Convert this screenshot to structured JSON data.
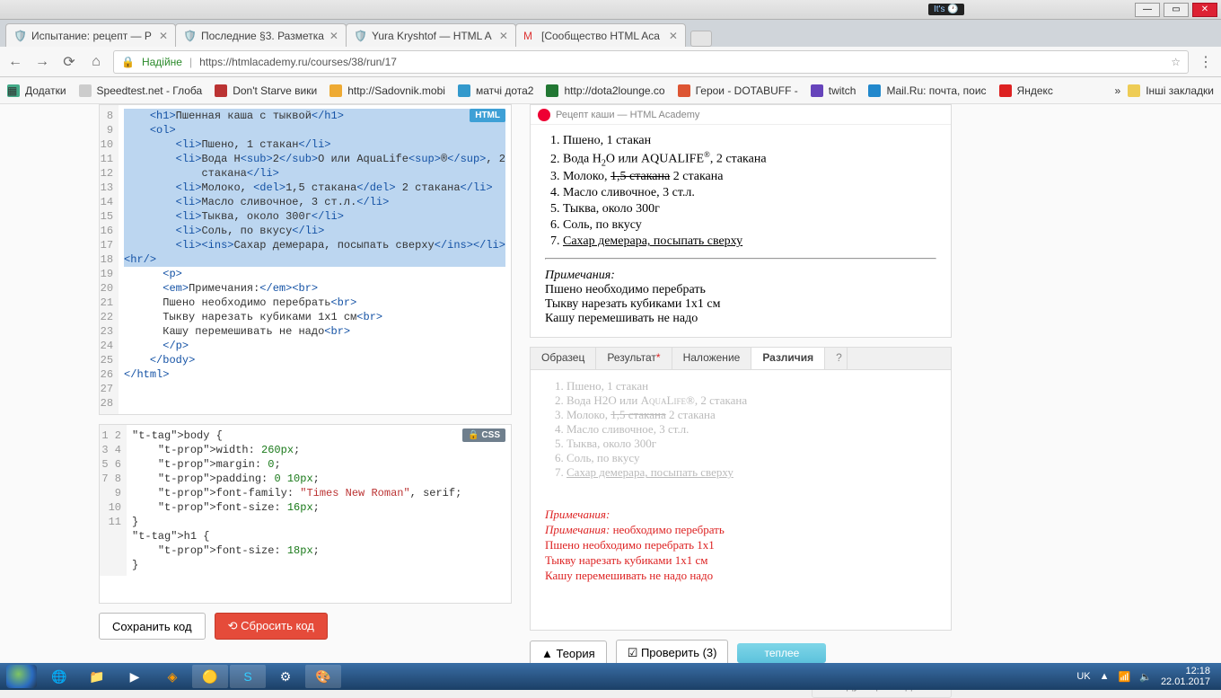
{
  "window": {
    "brand": "It's 🕐",
    "min": "—",
    "max": "▭",
    "close": "✕"
  },
  "tabs": [
    {
      "label": "Испытание: рецепт — Р",
      "close": "✕"
    },
    {
      "label": "Последние §3. Разметка",
      "close": "✕"
    },
    {
      "label": "Yura Kryshtof — HTML A",
      "close": "✕"
    },
    {
      "label": "[Сообщество HTML Aca",
      "close": "✕"
    }
  ],
  "toolbar": {
    "back": "←",
    "fwd": "→",
    "reload": "⟳",
    "home": "⌂",
    "secure": "Надійне",
    "url": "https://htmlacademy.ru/courses/38/run/17",
    "star": "☆",
    "menu": "⋮"
  },
  "bookmarks": {
    "apps": "Додатки",
    "items": [
      "Speedtest.net - Глоба",
      "Don't Starve вики",
      "http://Sadovnik.mobi",
      "матчі дота2",
      "http://dota2lounge.co",
      "Герои - DOTABUFF -",
      "twitch",
      "Mail.Ru: почта, поис",
      "Яндекс"
    ],
    "other": "Інші закладки"
  },
  "htmlEditor": {
    "badge": "HTML",
    "start": 8,
    "lines": [
      "    <h1>Пшенная каша с тыквой</h1>",
      "    <ol>",
      "        <li>Пшено, 1 стакан</li>",
      "        <li>Вода H<sub>2</sub>O или AquaLife<sup>®</sup>, 2\n            стакана</li>",
      "        <li>Молоко, <del>1,5 стакана</del> 2 стакана</li>",
      "        <li>Масло сливочное, 3 ст.л.</li>",
      "        <li>Тыква, около 300г</li>",
      "        <li>Соль, по вкусу</li>",
      "        <li><ins>Сахар демерара, посыпать сверху</ins></li>",
      "<hr/>",
      "",
      "      <p>",
      "      <em>Примечания:</em><br>",
      "      Пшено необходимо перебрать<br>",
      "      Тыкву нарезать кубиками 1x1 см<br>",
      "      Кашу перемешивать не надо<br>",
      "      </p>",
      "",
      "    </body>",
      "</html>"
    ]
  },
  "cssEditor": {
    "badge": "🔒 CSS",
    "lines": [
      "body {",
      "    width: 260px;",
      "    margin: 0;",
      "    padding: 0 10px;",
      "    font-family: \"Times New Roman\", serif;",
      "    font-size: 16px;",
      "}",
      "",
      "h1 {",
      "    font-size: 18px;",
      "}"
    ]
  },
  "buttons": {
    "save": "Сохранить код",
    "reset": "Сбросить код"
  },
  "preview": {
    "title": "Рецепт каши — HTML Academy",
    "items": [
      "Пшено, 1 стакан",
      "Вода H₂O или AquaLife®, 2 стакана",
      "Молоко, 1,5 стакана 2 стакана",
      "Масло сливочное, 3 ст.л.",
      "Тыква, около 300г",
      "Соль, по вкусу",
      "Сахар демерара, посыпать сверху"
    ],
    "notes_title": "Примечания:",
    "notes": [
      "Пшено необходимо перебрать",
      "Тыкву нарезать кубиками 1x1 см",
      "Кашу перемешивать не надо"
    ]
  },
  "diff": {
    "tabs": [
      "Образец",
      "Результат",
      "Наложение",
      "Различия"
    ],
    "help": "?",
    "ghost": [
      "Пшено, 1 стакан",
      "Вода H₂O или AquaLife®, 2 стакана",
      "Молоко, 1,5 стакана 2 стакана",
      "Масло сливочное, 3 ст.л.",
      "Тыква, около 300г",
      "Соль, по вкусу",
      "Сахар демерара, посыпать сверху"
    ],
    "redlines": [
      "Примечания:",
      "Примечания: необходимо перебрать",
      "Пшено необходимо перебрать 1x1",
      "Тыкву нарезать кубиками 1x1 см",
      "Кашу перемешивать не надо надо"
    ]
  },
  "actions": {
    "theory": "▲ Теория",
    "check": "☑ Проверить (3)",
    "warm": "теплее",
    "next": "Следующее задание"
  },
  "tray": {
    "lang": "UK",
    "net": "📶",
    "vol": "🔈",
    "flag": "▲",
    "time": "12:18",
    "date": "22.01.2017"
  }
}
